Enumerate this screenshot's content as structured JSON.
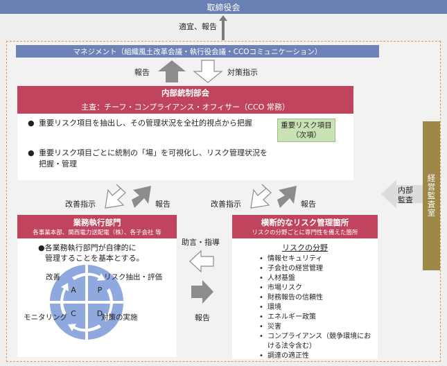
{
  "board": {
    "label": "取締役会"
  },
  "board_report": "適宜、報告",
  "management": {
    "label": "マネジメント（組織風土改革会議・執行役会議・CCOコミュニケーション）"
  },
  "mgmt_flow": {
    "report": "報告",
    "countermeasure": "対策指示"
  },
  "internal_control": {
    "title": "内部統制部会",
    "subtitle": "主査：チーフ・コンプライアンス・オフィサー（CCO 常務）",
    "bullets": [
      "重要リスク項目を抽出し、その管理状況を全社的視点から把握",
      "重要リスク項目ごとに統制の「場」を可視化し、リスク管理状況を",
      "把握・管理"
    ],
    "key_risk_box": [
      "重要リスク項目",
      "（次項）"
    ]
  },
  "left_flow": {
    "improve": "改善指示",
    "report": "報告"
  },
  "right_flow": {
    "improve": "改善指示",
    "report": "報告"
  },
  "business_units": {
    "title": "業務執行部門",
    "subtitle": "各事業本部、関西電力送配電（株）、各子会社 等",
    "text": [
      "●各業務執行部門が自律的に",
      "管理することを基本とする。"
    ],
    "cycle": {
      "quadrants": [
        "A",
        "P",
        "C",
        "D"
      ],
      "labels": {
        "improve": "改善",
        "extract": "リスク抽出・評価",
        "monitor": "モニタリング",
        "implement": "対策の実施"
      }
    }
  },
  "middle": {
    "advice": "助言・指導",
    "report": "報告"
  },
  "cross_risk": {
    "title": "横断的なリスク管理箇所",
    "subtitle": "リスクの分野ごとに専門性を備えた箇所",
    "field_title": "リスクの分野",
    "items": [
      "情報セキュリティ",
      "子会社の経営管理",
      "人材基盤",
      "市場リスク",
      "財務報告の信頼性",
      "環境",
      "エネルギー政策",
      "災害",
      "コンプライアンス（競争環境にお",
      "ける法令含む）",
      "調達の適正性"
    ]
  },
  "audit": {
    "internal": [
      "内部",
      "監査"
    ],
    "office": "経営監査室"
  },
  "colors": {
    "board_blue": "#6a7fb3",
    "header_red": "#c1445e",
    "key_green": "#c9e2b5",
    "audit_gold": "#9e8848",
    "cycle_blue": "#8fa8dd",
    "dash_orange": "#e8914a"
  }
}
